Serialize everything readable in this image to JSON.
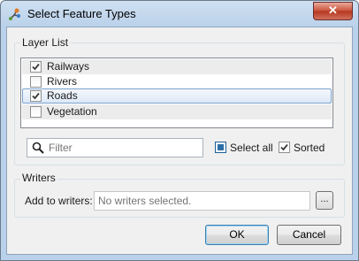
{
  "window": {
    "title": "Select Feature Types",
    "close_glyph": "✕"
  },
  "layer_list": {
    "group_label": "Layer List",
    "rows": [
      {
        "label": "Railways",
        "checked": true
      },
      {
        "label": "Rivers",
        "checked": false
      },
      {
        "label": "Roads",
        "checked": true
      },
      {
        "label": "Vegetation",
        "checked": false
      }
    ],
    "filter_placeholder": "Filter",
    "select_all_label": "Select all",
    "sorted_label": "Sorted",
    "select_all_checked": "partial",
    "sorted_checked": true
  },
  "writers": {
    "group_label": "Writers",
    "add_to_label": "Add to writers:",
    "placeholder": "No writers selected.",
    "browse_label": "..."
  },
  "buttons": {
    "ok": "OK",
    "cancel": "Cancel"
  },
  "colors": {
    "accent": "#1d5f95",
    "selection": "#dde9f7"
  }
}
